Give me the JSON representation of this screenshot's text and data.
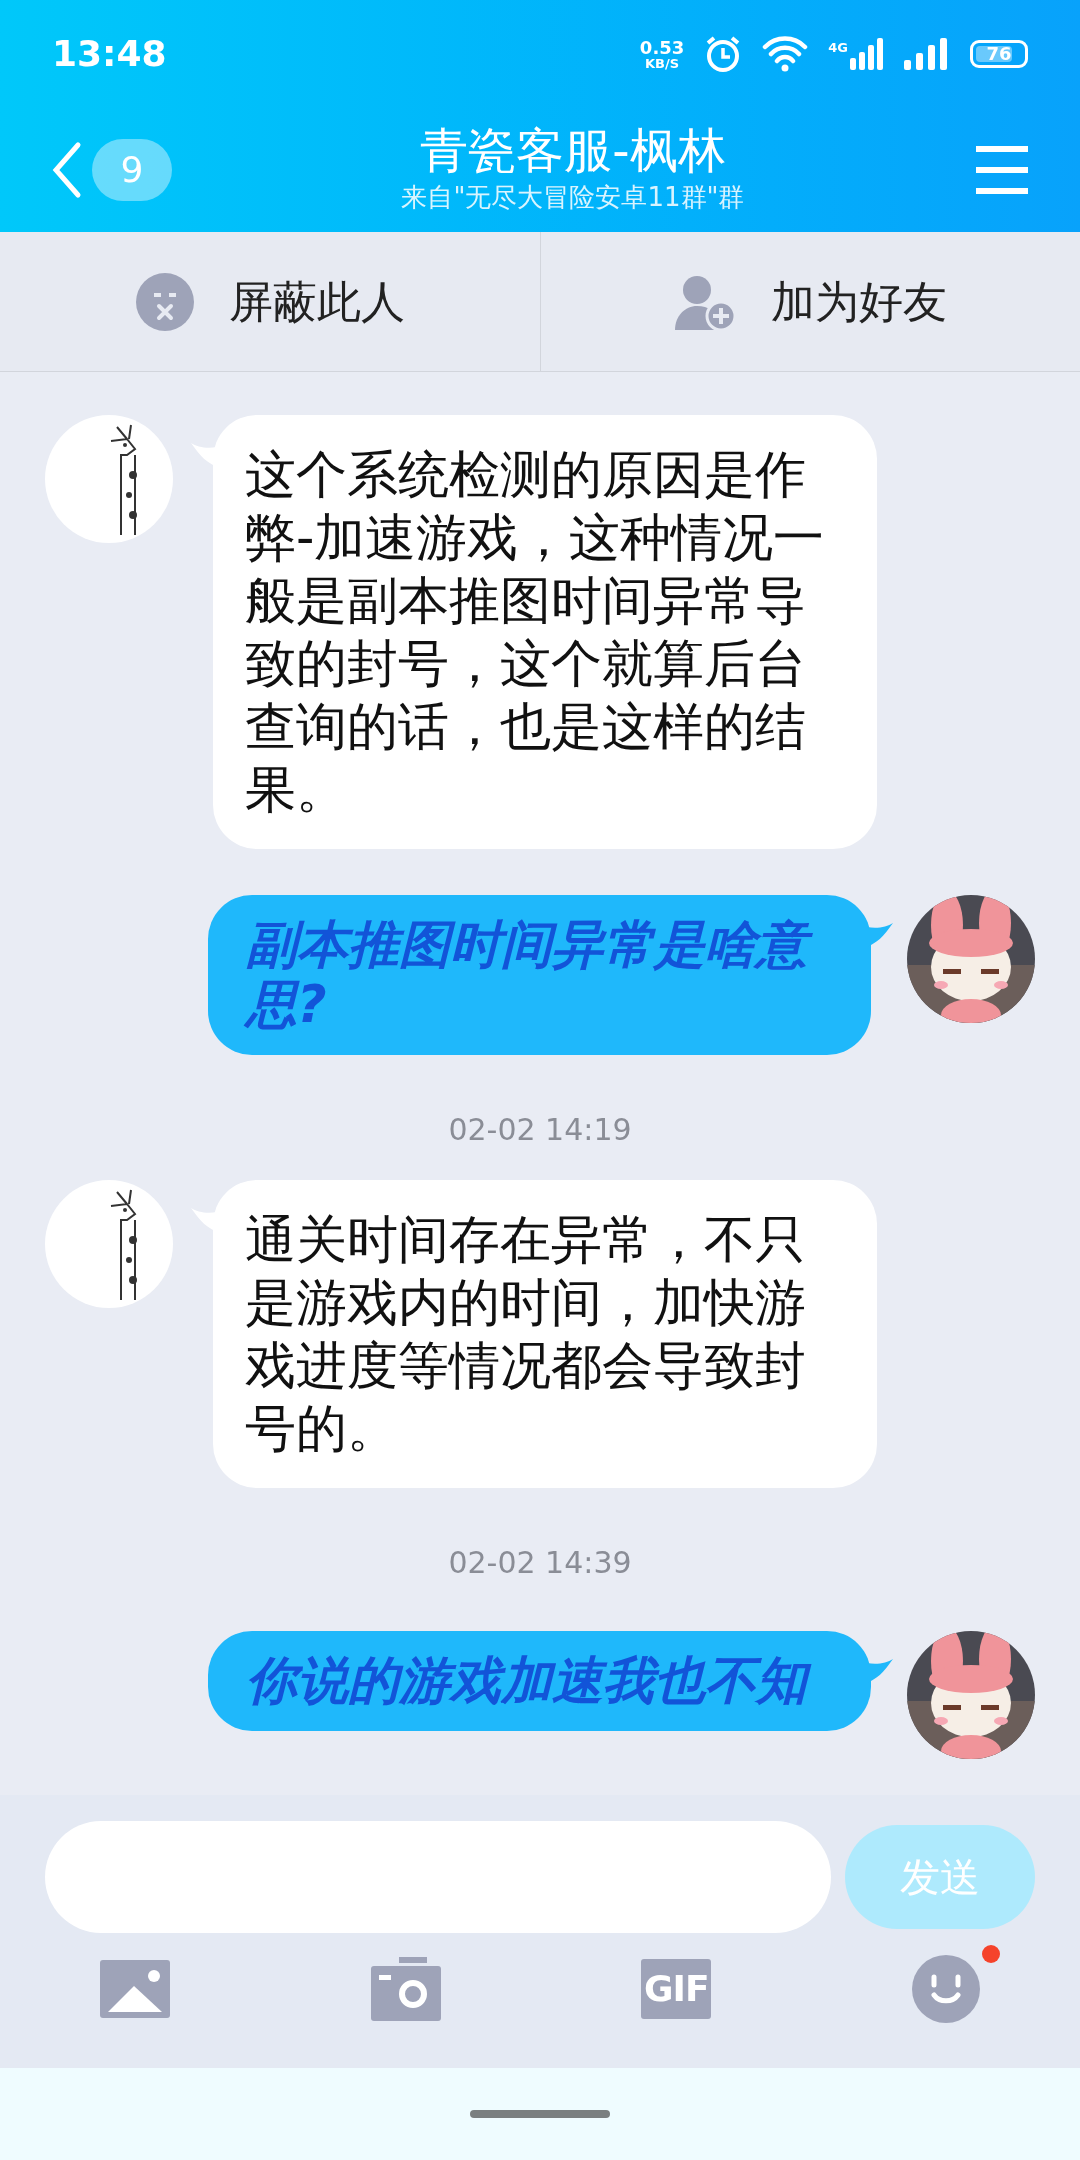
{
  "status_bar": {
    "time": "13:48",
    "speed_value": "0.53",
    "speed_unit": "KB/S",
    "network": "4G",
    "battery": "76"
  },
  "header": {
    "unread": "9",
    "title": "青瓷客服-枫林",
    "subtitle": "来自\"无尽大冒险安卓11群\"群"
  },
  "actions": [
    {
      "kind": "block",
      "label": "屏蔽此人"
    },
    {
      "kind": "add",
      "label": "加为好友"
    }
  ],
  "messages": [
    {
      "kind": "incoming",
      "text": "这个系统检测的原因是作弊-加速游戏，这种情况一般是副本推图时间异常导致的封号，这个就算后台查询的话，也是这样的结果。"
    },
    {
      "kind": "outgoing",
      "text": "副本推图时间异常是啥意思?"
    },
    {
      "kind": "time",
      "text": "02-02 14:19"
    },
    {
      "kind": "incoming",
      "text": "通关时间存在异常，不只是游戏内的时间，加快游戏进度等情况都会导致封号的。"
    },
    {
      "kind": "time",
      "text": "02-02 14:39"
    },
    {
      "kind": "outgoing",
      "text": "你说的游戏加速我也不知"
    }
  ],
  "composer": {
    "send": "发送",
    "gif": "GIF",
    "emoji_badge": true
  }
}
